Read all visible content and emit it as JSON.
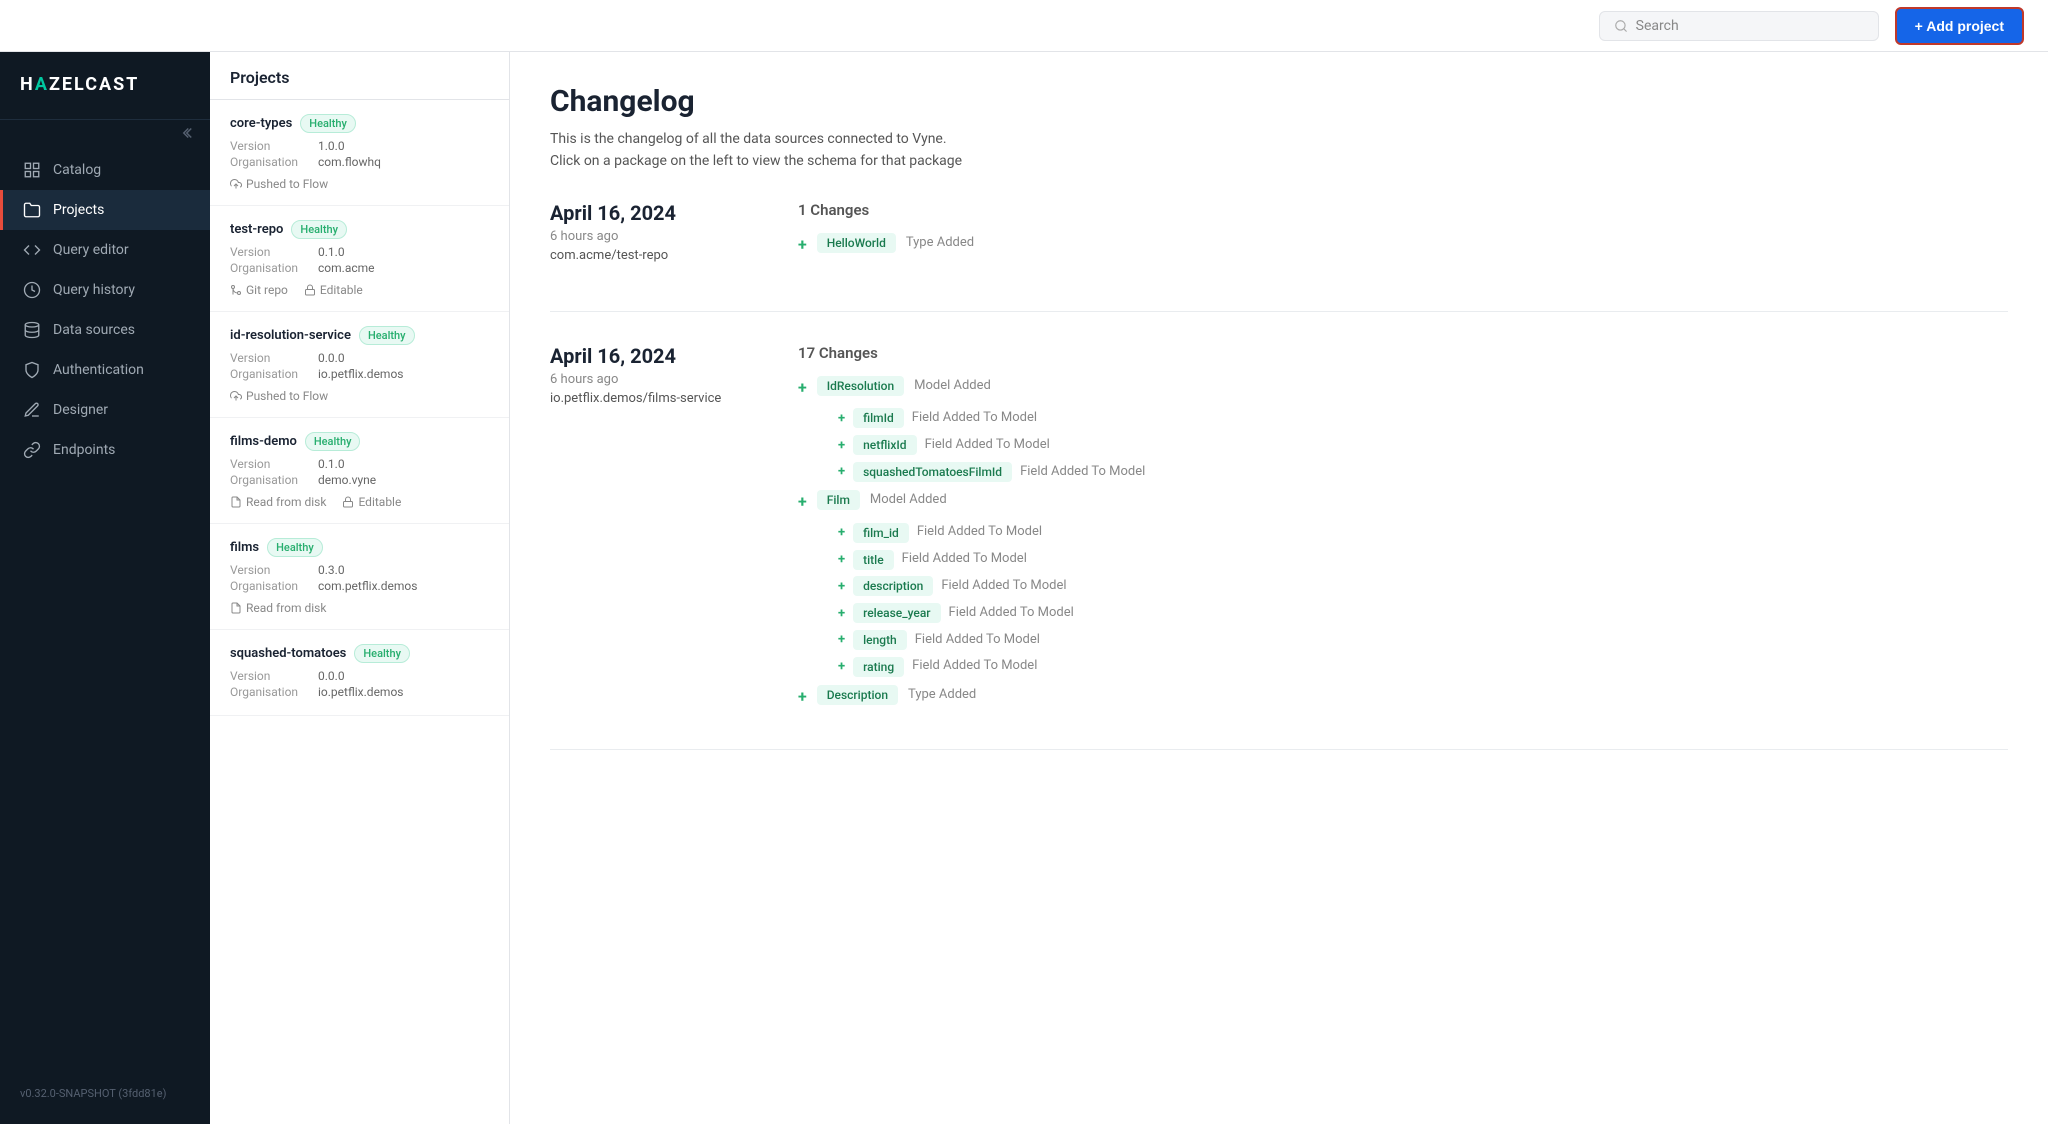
{
  "app": {
    "logo": "HAZELCAST",
    "logo_accent": ":",
    "version": "v0.32.0-SNAPSHOT (3fdd81e)"
  },
  "topbar": {
    "search_placeholder": "Search",
    "add_project_label": "+ Add project"
  },
  "sidebar": {
    "items": [
      {
        "id": "catalog",
        "label": "Catalog",
        "icon": "grid-icon",
        "active": false
      },
      {
        "id": "projects",
        "label": "Projects",
        "icon": "folder-icon",
        "active": true
      },
      {
        "id": "query-editor",
        "label": "Query editor",
        "icon": "code-icon",
        "active": false
      },
      {
        "id": "query-history",
        "label": "Query history",
        "icon": "clock-icon",
        "active": false
      },
      {
        "id": "data-sources",
        "label": "Data sources",
        "icon": "database-icon",
        "active": false
      },
      {
        "id": "authentication",
        "label": "Authentication",
        "icon": "shield-icon",
        "active": false
      },
      {
        "id": "designer",
        "label": "Designer",
        "icon": "pen-icon",
        "active": false
      },
      {
        "id": "endpoints",
        "label": "Endpoints",
        "icon": "link-icon",
        "active": false
      }
    ]
  },
  "projects_panel": {
    "title": "Projects",
    "items": [
      {
        "name": "core-types",
        "status": "Healthy",
        "version_label": "Version",
        "version": "1.0.0",
        "org_label": "Organisation",
        "org": "com.flowhq",
        "tags": [
          {
            "icon": "push-icon",
            "label": "Pushed to Flow"
          }
        ]
      },
      {
        "name": "test-repo",
        "status": "Healthy",
        "version_label": "Version",
        "version": "0.1.0",
        "org_label": "Organisation",
        "org": "com.acme",
        "tags": [
          {
            "icon": "git-icon",
            "label": "Git repo"
          },
          {
            "icon": "lock-icon",
            "label": "Editable"
          }
        ]
      },
      {
        "name": "id-resolution-service",
        "status": "Healthy",
        "version_label": "Version",
        "version": "0.0.0",
        "org_label": "Organisation",
        "org": "io.petflix.demos",
        "tags": [
          {
            "icon": "push-icon",
            "label": "Pushed to Flow"
          }
        ]
      },
      {
        "name": "films-demo",
        "status": "Healthy",
        "version_label": "Version",
        "version": "0.1.0",
        "org_label": "Organisation",
        "org": "demo.vyne",
        "tags": [
          {
            "icon": "disk-icon",
            "label": "Read from disk"
          },
          {
            "icon": "lock-icon",
            "label": "Editable"
          }
        ]
      },
      {
        "name": "films",
        "status": "Healthy",
        "version_label": "Version",
        "version": "0.3.0",
        "org_label": "Organisation",
        "org": "com.petflix.demos",
        "tags": [
          {
            "icon": "disk-icon",
            "label": "Read from disk"
          }
        ]
      },
      {
        "name": "squashed-tomatoes",
        "status": "Healthy",
        "version_label": "Version",
        "version": "0.0.0",
        "org_label": "Organisation",
        "org": "io.petflix.demos",
        "tags": []
      }
    ]
  },
  "changelog": {
    "title": "Changelog",
    "description1": "This is the changelog of all the data sources connected to Vyne.",
    "description2": "Click on a package on the left to view the schema for that package",
    "sections": [
      {
        "date": "April 16, 2024",
        "time_ago": "6 hours ago",
        "source": "com.acme/test-repo",
        "changes_count": "1 Changes",
        "entries": [
          {
            "type": "top",
            "tag": "HelloWorld",
            "label": "Type Added",
            "sub_entries": []
          }
        ]
      },
      {
        "date": "April 16, 2024",
        "time_ago": "6 hours ago",
        "source": "io.petflix.demos/films-service",
        "changes_count": "17 Changes",
        "entries": [
          {
            "type": "top",
            "tag": "IdResolution",
            "label": "Model Added",
            "sub_entries": [
              {
                "tag": "filmId",
                "label": "Field Added To Model"
              },
              {
                "tag": "netflixId",
                "label": "Field Added To Model"
              },
              {
                "tag": "squashedTomatoesFilmId",
                "label": "Field Added To Model"
              }
            ]
          },
          {
            "type": "top",
            "tag": "Film",
            "label": "Model Added",
            "sub_entries": [
              {
                "tag": "film_id",
                "label": "Field Added To Model"
              },
              {
                "tag": "title",
                "label": "Field Added To Model"
              },
              {
                "tag": "description",
                "label": "Field Added To Model"
              },
              {
                "tag": "release_year",
                "label": "Field Added To Model"
              },
              {
                "tag": "length",
                "label": "Field Added To Model"
              },
              {
                "tag": "rating",
                "label": "Field Added To Model"
              }
            ]
          },
          {
            "type": "top",
            "tag": "Description",
            "label": "Type Added",
            "sub_entries": []
          }
        ]
      }
    ]
  }
}
